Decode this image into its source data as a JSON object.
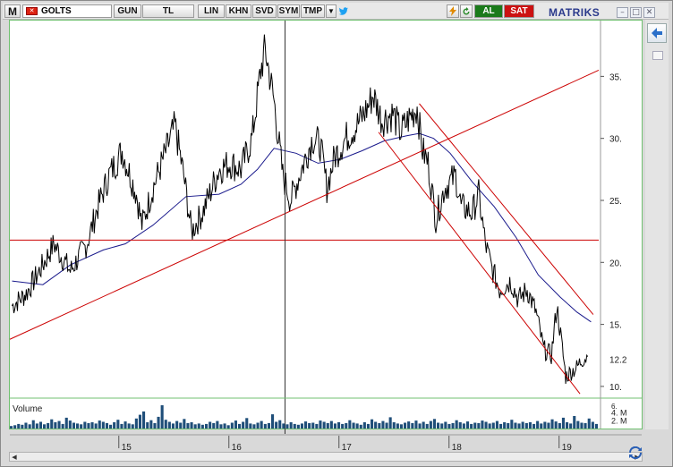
{
  "toolbar": {
    "menu_letter": "M",
    "symbol": "GOLTS",
    "buttons": [
      "GUN",
      "TL",
      "LIN",
      "KHN",
      "SVD",
      "SYM",
      "TMP"
    ],
    "buy_label": "AL",
    "sell_label": "SAT",
    "brand": "MATRIKS"
  },
  "colors": {
    "price_line": "#000000",
    "moving_average": "#1a1a8c",
    "trendlines": "#cc0000",
    "volume_bars": "#1f4e79",
    "buy_button": "#1a7a1a",
    "sell_button": "#cc1111",
    "panel_border": "#70c070"
  },
  "chart_data": {
    "type": "line",
    "title": "",
    "x_ticks": [
      "15",
      "16",
      "17",
      "18",
      "19"
    ],
    "y_ticks": [
      10,
      15,
      20,
      25,
      30,
      35
    ],
    "last_price_label": "12.2",
    "ylim": [
      9.2,
      39.5
    ],
    "price_waypoints": [
      {
        "x": 14.02,
        "y": 16.5
      },
      {
        "x": 14.15,
        "y": 17.5
      },
      {
        "x": 14.3,
        "y": 19.8
      },
      {
        "x": 14.4,
        "y": 21.5
      },
      {
        "x": 14.55,
        "y": 19.3
      },
      {
        "x": 14.7,
        "y": 21.5
      },
      {
        "x": 14.8,
        "y": 24.5
      },
      {
        "x": 14.9,
        "y": 27.0
      },
      {
        "x": 15.02,
        "y": 29.0
      },
      {
        "x": 15.15,
        "y": 25.5
      },
      {
        "x": 15.2,
        "y": 23.0
      },
      {
        "x": 15.3,
        "y": 26.0
      },
      {
        "x": 15.4,
        "y": 28.5
      },
      {
        "x": 15.5,
        "y": 31.0
      },
      {
        "x": 15.58,
        "y": 27.0
      },
      {
        "x": 15.65,
        "y": 22.5
      },
      {
        "x": 15.75,
        "y": 24.0
      },
      {
        "x": 15.9,
        "y": 27.5
      },
      {
        "x": 16.0,
        "y": 28.0
      },
      {
        "x": 16.1,
        "y": 27.5
      },
      {
        "x": 16.2,
        "y": 30.0
      },
      {
        "x": 16.28,
        "y": 35.5
      },
      {
        "x": 16.32,
        "y": 37.2
      },
      {
        "x": 16.4,
        "y": 33.0
      },
      {
        "x": 16.48,
        "y": 27.0
      },
      {
        "x": 16.55,
        "y": 25.0
      },
      {
        "x": 16.65,
        "y": 27.5
      },
      {
        "x": 16.75,
        "y": 30.0
      },
      {
        "x": 16.82,
        "y": 29.5
      },
      {
        "x": 16.88,
        "y": 26.0
      },
      {
        "x": 16.95,
        "y": 28.5
      },
      {
        "x": 17.05,
        "y": 30.0
      },
      {
        "x": 17.15,
        "y": 31.0
      },
      {
        "x": 17.25,
        "y": 32.5
      },
      {
        "x": 17.3,
        "y": 33.5
      },
      {
        "x": 17.38,
        "y": 31.5
      },
      {
        "x": 17.48,
        "y": 32.0
      },
      {
        "x": 17.55,
        "y": 30.5
      },
      {
        "x": 17.62,
        "y": 31.5
      },
      {
        "x": 17.7,
        "y": 32.5
      },
      {
        "x": 17.75,
        "y": 29.0
      },
      {
        "x": 17.8,
        "y": 28.0
      },
      {
        "x": 17.87,
        "y": 23.5
      },
      {
        "x": 17.95,
        "y": 26.0
      },
      {
        "x": 18.05,
        "y": 27.0
      },
      {
        "x": 18.1,
        "y": 24.5
      },
      {
        "x": 18.2,
        "y": 24.0
      },
      {
        "x": 18.26,
        "y": 25.5
      },
      {
        "x": 18.32,
        "y": 21.5
      },
      {
        "x": 18.38,
        "y": 19.5
      },
      {
        "x": 18.45,
        "y": 17.8
      },
      {
        "x": 18.55,
        "y": 18.5
      },
      {
        "x": 18.62,
        "y": 17.0
      },
      {
        "x": 18.7,
        "y": 17.8
      },
      {
        "x": 18.78,
        "y": 16.0
      },
      {
        "x": 18.85,
        "y": 13.0
      },
      {
        "x": 18.92,
        "y": 12.5
      },
      {
        "x": 18.97,
        "y": 16.5
      },
      {
        "x": 19.02,
        "y": 13.0
      },
      {
        "x": 19.05,
        "y": 10.8
      },
      {
        "x": 19.1,
        "y": 11.2
      },
      {
        "x": 19.15,
        "y": 11.5
      },
      {
        "x": 19.2,
        "y": 12.2
      },
      {
        "x": 19.25,
        "y": 12.4
      }
    ],
    "ma_waypoints": [
      {
        "x": 14.02,
        "y": 18.5
      },
      {
        "x": 14.3,
        "y": 18.2
      },
      {
        "x": 14.55,
        "y": 19.8
      },
      {
        "x": 14.85,
        "y": 21.0
      },
      {
        "x": 15.05,
        "y": 21.5
      },
      {
        "x": 15.3,
        "y": 23.0
      },
      {
        "x": 15.6,
        "y": 25.3
      },
      {
        "x": 15.9,
        "y": 25.5
      },
      {
        "x": 16.1,
        "y": 26.3
      },
      {
        "x": 16.25,
        "y": 27.5
      },
      {
        "x": 16.4,
        "y": 29.2
      },
      {
        "x": 16.6,
        "y": 28.8
      },
      {
        "x": 16.8,
        "y": 28.0
      },
      {
        "x": 17.0,
        "y": 28.3
      },
      {
        "x": 17.2,
        "y": 29.0
      },
      {
        "x": 17.4,
        "y": 29.8
      },
      {
        "x": 17.6,
        "y": 30.2
      },
      {
        "x": 17.72,
        "y": 30.4
      },
      {
        "x": 17.85,
        "y": 30.0
      },
      {
        "x": 18.0,
        "y": 28.8
      },
      {
        "x": 18.2,
        "y": 26.5
      },
      {
        "x": 18.4,
        "y": 24.5
      },
      {
        "x": 18.6,
        "y": 22.0
      },
      {
        "x": 18.8,
        "y": 19.0
      },
      {
        "x": 19.0,
        "y": 17.2
      },
      {
        "x": 19.15,
        "y": 16.0
      },
      {
        "x": 19.28,
        "y": 15.2
      }
    ],
    "trendlines": [
      {
        "x1": 14.0,
        "y1": 13.8,
        "x2": 19.35,
        "y2": 35.5
      },
      {
        "x1": 14.0,
        "y1": 21.8,
        "x2": 19.35,
        "y2": 21.8
      },
      {
        "x1": 17.72,
        "y1": 32.8,
        "x2": 19.3,
        "y2": 15.8
      },
      {
        "x1": 17.35,
        "y1": 30.5,
        "x2": 19.18,
        "y2": 9.4
      }
    ],
    "cursor_x": 16.5,
    "volume": {
      "label": "Volume",
      "y_ticks": [
        "4. M",
        "2. M"
      ],
      "top_tick": "6.",
      "bars": [
        0.6,
        0.8,
        1.1,
        0.9,
        1.4,
        1.0,
        2.0,
        1.2,
        1.6,
        1.0,
        1.3,
        2.2,
        1.5,
        1.8,
        1.1,
        2.6,
        1.9,
        1.4,
        1.2,
        1.0,
        1.6,
        1.3,
        1.5,
        1.2,
        1.9,
        1.6,
        1.3,
        0.9,
        1.5,
        2.1,
        1.1,
        1.7,
        1.2,
        1.0,
        2.4,
        3.3,
        4.1,
        1.5,
        2.0,
        1.3,
        2.8,
        5.6,
        2.1,
        1.6,
        1.2,
        1.8,
        1.4,
        2.3,
        1.3,
        1.5,
        1.0,
        1.2,
        0.9,
        1.1,
        1.6,
        1.3,
        1.8,
        1.0,
        1.2,
        0.8,
        1.4,
        1.9,
        1.1,
        1.6,
        2.5,
        1.2,
        1.0,
        1.4,
        1.8,
        1.1,
        1.3,
        3.4,
        1.6,
        2.0,
        1.2,
        1.0,
        1.5,
        1.1,
        0.9,
        1.2,
        1.7,
        1.3,
        1.4,
        1.1,
        1.9,
        1.6,
        1.3,
        1.8,
        1.2,
        1.5,
        1.1,
        1.3,
        2.0,
        1.4,
        1.2,
        0.9,
        1.5,
        1.1,
        2.2,
        1.6,
        1.3,
        1.8,
        1.4,
        2.7,
        1.5,
        1.2,
        1.0,
        1.4,
        1.7,
        1.3,
        1.9,
        1.2,
        1.6,
        1.1,
        1.8,
        2.3,
        1.4,
        1.2,
        1.6,
        1.1,
        1.3,
        2.0,
        1.5,
        1.2,
        1.7,
        1.1,
        1.4,
        1.3,
        1.9,
        1.6,
        1.2,
        1.4,
        1.8,
        1.1,
        1.5,
        1.3,
        2.1,
        1.4,
        1.2,
        1.6,
        1.3,
        1.5,
        1.1,
        1.8,
        1.2,
        1.6,
        1.4,
        2.2,
        1.7,
        1.3,
        2.6,
        1.5,
        1.2,
        3.0,
        1.8,
        1.4,
        1.3,
        2.4,
        1.6,
        1.1
      ]
    }
  }
}
